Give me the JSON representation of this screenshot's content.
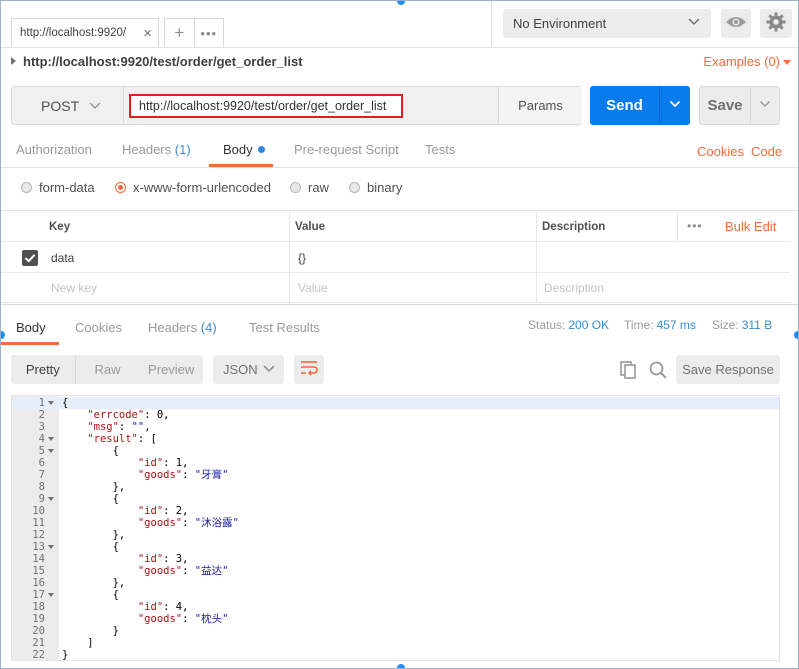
{
  "tab": {
    "title": "http://localhost:9920/",
    "close": "×"
  },
  "tab_actions": {
    "add": "+",
    "more": "•••"
  },
  "environment": {
    "selected": "No Environment"
  },
  "breadcrumb": {
    "title": "http://localhost:9920/test/order/get_order_list",
    "examples": "Examples (0)"
  },
  "request": {
    "method": "POST",
    "url": "http://localhost:9920/test/order/get_order_list",
    "params_label": "Params",
    "send_label": "Send",
    "save_label": "Save"
  },
  "request_tabs": {
    "authorization": "Authorization",
    "headers": "Headers",
    "headers_count": "(1)",
    "body": "Body",
    "pre_request": "Pre-request Script",
    "tests": "Tests",
    "cookies": "Cookies",
    "code": "Code"
  },
  "body_types": {
    "form_data": "form-data",
    "urlencoded": "x-www-form-urlencoded",
    "raw": "raw",
    "binary": "binary",
    "selected": "x-www-form-urlencoded"
  },
  "kv_table": {
    "headers": {
      "key": "Key",
      "value": "Value",
      "description": "Description",
      "dots": "•••",
      "bulk_edit": "Bulk Edit"
    },
    "rows": [
      {
        "key": "data",
        "value": "{}",
        "description": ""
      }
    ],
    "placeholders": {
      "key": "New key",
      "value": "Value",
      "description": "Description"
    }
  },
  "response_tabs": {
    "body": "Body",
    "cookies": "Cookies",
    "headers": "Headers",
    "headers_count": "(4)",
    "test_results": "Test Results"
  },
  "response_status": {
    "status_label": "Status:",
    "status_value": "200 OK",
    "time_label": "Time:",
    "time_value": "457 ms",
    "size_label": "Size:",
    "size_value": "311 B"
  },
  "response_toolbar": {
    "pretty": "Pretty",
    "raw": "Raw",
    "preview": "Preview",
    "format": "JSON",
    "save_response": "Save Response"
  },
  "code_lines": [
    {
      "n": "1",
      "fold": true,
      "text": "{"
    },
    {
      "n": "2",
      "fold": false,
      "text": "    \"errcode\": 0,"
    },
    {
      "n": "3",
      "fold": false,
      "text": "    \"msg\": \"\","
    },
    {
      "n": "4",
      "fold": true,
      "text": "    \"result\": ["
    },
    {
      "n": "5",
      "fold": true,
      "text": "        {"
    },
    {
      "n": "6",
      "fold": false,
      "text": "            \"id\": 1,"
    },
    {
      "n": "7",
      "fold": false,
      "text": "            \"goods\": \"牙膏\""
    },
    {
      "n": "8",
      "fold": false,
      "text": "        },"
    },
    {
      "n": "9",
      "fold": true,
      "text": "        {"
    },
    {
      "n": "10",
      "fold": false,
      "text": "            \"id\": 2,"
    },
    {
      "n": "11",
      "fold": false,
      "text": "            \"goods\": \"沐浴露\""
    },
    {
      "n": "12",
      "fold": false,
      "text": "        },"
    },
    {
      "n": "13",
      "fold": true,
      "text": "        {"
    },
    {
      "n": "14",
      "fold": false,
      "text": "            \"id\": 3,"
    },
    {
      "n": "15",
      "fold": false,
      "text": "            \"goods\": \"益达\""
    },
    {
      "n": "16",
      "fold": false,
      "text": "        },"
    },
    {
      "n": "17",
      "fold": true,
      "text": "        {"
    },
    {
      "n": "18",
      "fold": false,
      "text": "            \"id\": 4,"
    },
    {
      "n": "19",
      "fold": false,
      "text": "            \"goods\": \"枕头\""
    },
    {
      "n": "20",
      "fold": false,
      "text": "        }"
    },
    {
      "n": "21",
      "fold": false,
      "text": "    ]"
    },
    {
      "n": "22",
      "fold": false,
      "text": "}"
    }
  ],
  "colors": {
    "accent": "#f26b3a",
    "send": "#097bed",
    "link_blue": "#3d8bd5",
    "url_highlight_border": "#e02020"
  },
  "icons": {
    "env_dropdown": "chevron-down-icon",
    "eye": "eye-icon",
    "gear": "gear-icon",
    "wrap": "wrap-lines-icon",
    "copy": "copy-icon",
    "search": "search-icon",
    "checkbox": "checkmark-icon"
  }
}
